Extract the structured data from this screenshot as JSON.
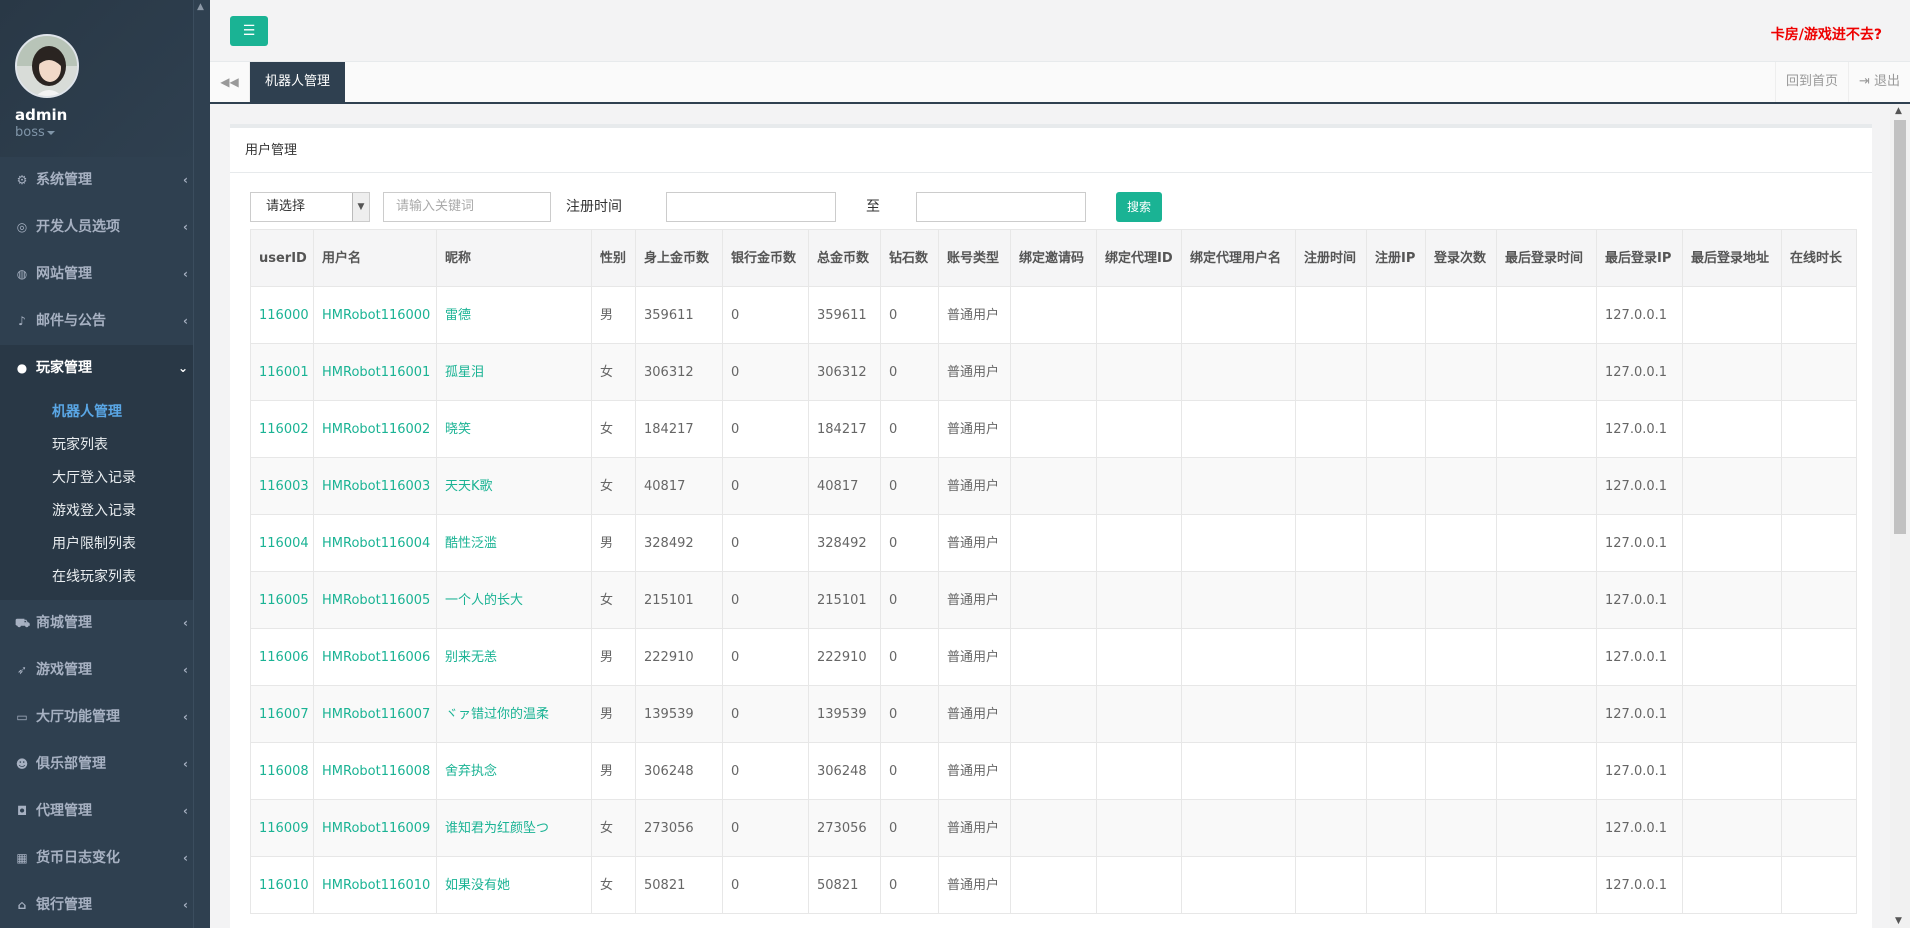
{
  "sidebar": {
    "username": "admin",
    "role": "boss",
    "menu": [
      {
        "label": "系统管理",
        "icon": "gears-icon"
      },
      {
        "label": "开发人员选项",
        "icon": "gamepad-icon"
      },
      {
        "label": "网站管理",
        "icon": "globe-icon"
      },
      {
        "label": "邮件与公告",
        "icon": "bell-icon"
      },
      {
        "label": "玩家管理",
        "icon": "user-icon"
      },
      {
        "label": "商城管理",
        "icon": "cart-icon"
      },
      {
        "label": "游戏管理",
        "icon": "rocket-icon"
      },
      {
        "label": "大厅功能管理",
        "icon": "desktop-icon"
      },
      {
        "label": "俱乐部管理",
        "icon": "users-icon"
      },
      {
        "label": "代理管理",
        "icon": "lock-icon"
      },
      {
        "label": "货币日志变化",
        "icon": "calendar-icon"
      },
      {
        "label": "银行管理",
        "icon": "bank-icon"
      }
    ],
    "submenu": [
      "机器人管理",
      "玩家列表",
      "大厅登入记录",
      "游戏登入记录",
      "用户限制列表",
      "在线玩家列表"
    ]
  },
  "topbar": {
    "warning": "卡房/游戏进不去?"
  },
  "tabs": {
    "active": "机器人管理",
    "home": "回到首页",
    "logout": "退出"
  },
  "panel": {
    "title": "用户管理",
    "select_label": "请选择",
    "keyword_placeholder": "请输入关键词",
    "reg_time_label": "注册时间",
    "to_label": "至",
    "search_label": "搜索"
  },
  "table": {
    "headers": [
      "userID",
      "用户名",
      "昵称",
      "性别",
      "身上金币数",
      "银行金币数",
      "总金币数",
      "钻石数",
      "账号类型",
      "绑定邀请码",
      "绑定代理ID",
      "绑定代理用户名",
      "注册时间",
      "注册IP",
      "登录次数",
      "最后登录时间",
      "最后登录IP",
      "最后登录地址",
      "在线时长"
    ],
    "rows": [
      [
        "116000",
        "HMRobot116000",
        "雷德",
        "男",
        "359611",
        "0",
        "359611",
        "0",
        "普通用户",
        "",
        "",
        "",
        "",
        "",
        "",
        "",
        "127.0.0.1",
        "",
        ""
      ],
      [
        "116001",
        "HMRobot116001",
        "孤星泪",
        "女",
        "306312",
        "0",
        "306312",
        "0",
        "普通用户",
        "",
        "",
        "",
        "",
        "",
        "",
        "",
        "127.0.0.1",
        "",
        ""
      ],
      [
        "116002",
        "HMRobot116002",
        "晓笑",
        "女",
        "184217",
        "0",
        "184217",
        "0",
        "普通用户",
        "",
        "",
        "",
        "",
        "",
        "",
        "",
        "127.0.0.1",
        "",
        ""
      ],
      [
        "116003",
        "HMRobot116003",
        "天天K歌",
        "女",
        "40817",
        "0",
        "40817",
        "0",
        "普通用户",
        "",
        "",
        "",
        "",
        "",
        "",
        "",
        "127.0.0.1",
        "",
        ""
      ],
      [
        "116004",
        "HMRobot116004",
        "酷性泛滥",
        "男",
        "328492",
        "0",
        "328492",
        "0",
        "普通用户",
        "",
        "",
        "",
        "",
        "",
        "",
        "",
        "127.0.0.1",
        "",
        ""
      ],
      [
        "116005",
        "HMRobot116005",
        "一个人的长大",
        "女",
        "215101",
        "0",
        "215101",
        "0",
        "普通用户",
        "",
        "",
        "",
        "",
        "",
        "",
        "",
        "127.0.0.1",
        "",
        ""
      ],
      [
        "116006",
        "HMRobot116006",
        "别来无恙",
        "男",
        "222910",
        "0",
        "222910",
        "0",
        "普通用户",
        "",
        "",
        "",
        "",
        "",
        "",
        "",
        "127.0.0.1",
        "",
        ""
      ],
      [
        "116007",
        "HMRobot116007",
        "ヾァ错过你的温柔",
        "男",
        "139539",
        "0",
        "139539",
        "0",
        "普通用户",
        "",
        "",
        "",
        "",
        "",
        "",
        "",
        "127.0.0.1",
        "",
        ""
      ],
      [
        "116008",
        "HMRobot116008",
        "舍弃执念",
        "男",
        "306248",
        "0",
        "306248",
        "0",
        "普通用户",
        "",
        "",
        "",
        "",
        "",
        "",
        "",
        "127.0.0.1",
        "",
        ""
      ],
      [
        "116009",
        "HMRobot116009",
        "谁知君为红颜坠つ",
        "女",
        "273056",
        "0",
        "273056",
        "0",
        "普通用户",
        "",
        "",
        "",
        "",
        "",
        "",
        "",
        "127.0.0.1",
        "",
        ""
      ],
      [
        "116010",
        "HMRobot116010",
        "如果没有她",
        "女",
        "50821",
        "0",
        "50821",
        "0",
        "普通用户",
        "",
        "",
        "",
        "",
        "",
        "",
        "",
        "127.0.0.1",
        "",
        ""
      ]
    ]
  }
}
